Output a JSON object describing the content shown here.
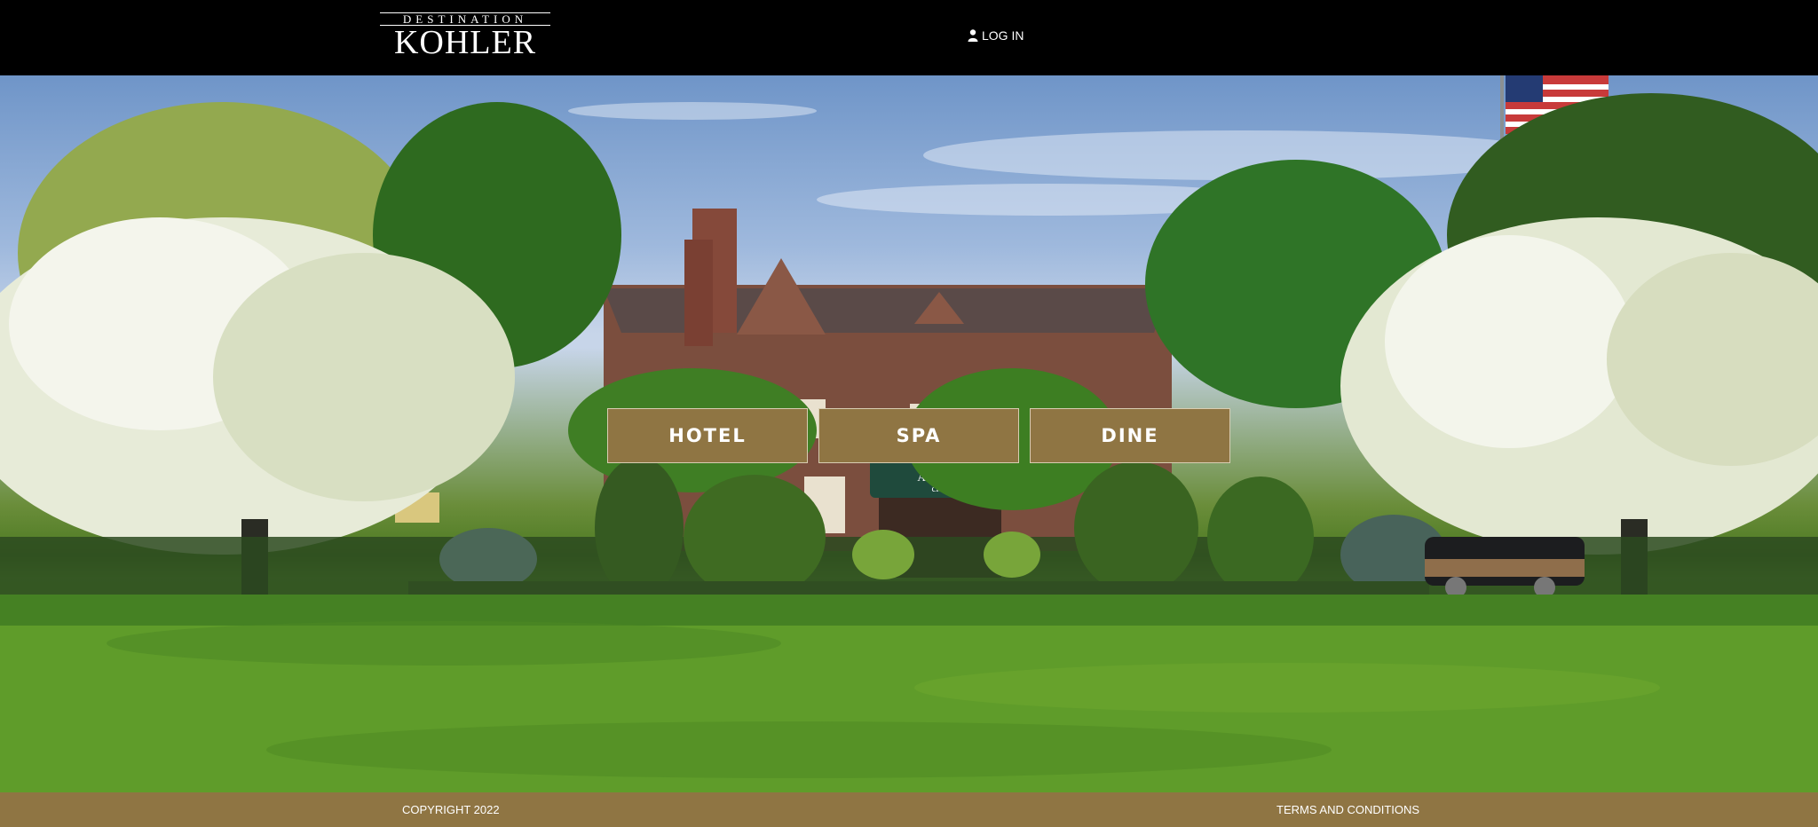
{
  "header": {
    "logo_top": "DESTINATION",
    "logo_main": "KOHLER",
    "login_label": "LOG IN",
    "login_icon": "user-icon"
  },
  "hero": {
    "awning_text_1": "the",
    "awning_text_2": "American",
    "awning_text_3": "club"
  },
  "nav": {
    "hotel": "HOTEL",
    "spa": "SPA",
    "dine": "DINE"
  },
  "footer": {
    "copyright": "COPYRIGHT 2022",
    "terms": "TERMS AND CONDITIONS"
  },
  "colors": {
    "header_bg": "#000000",
    "accent": "#8f7543",
    "button_border": "#d8cdb2",
    "text": "#ffffff"
  }
}
